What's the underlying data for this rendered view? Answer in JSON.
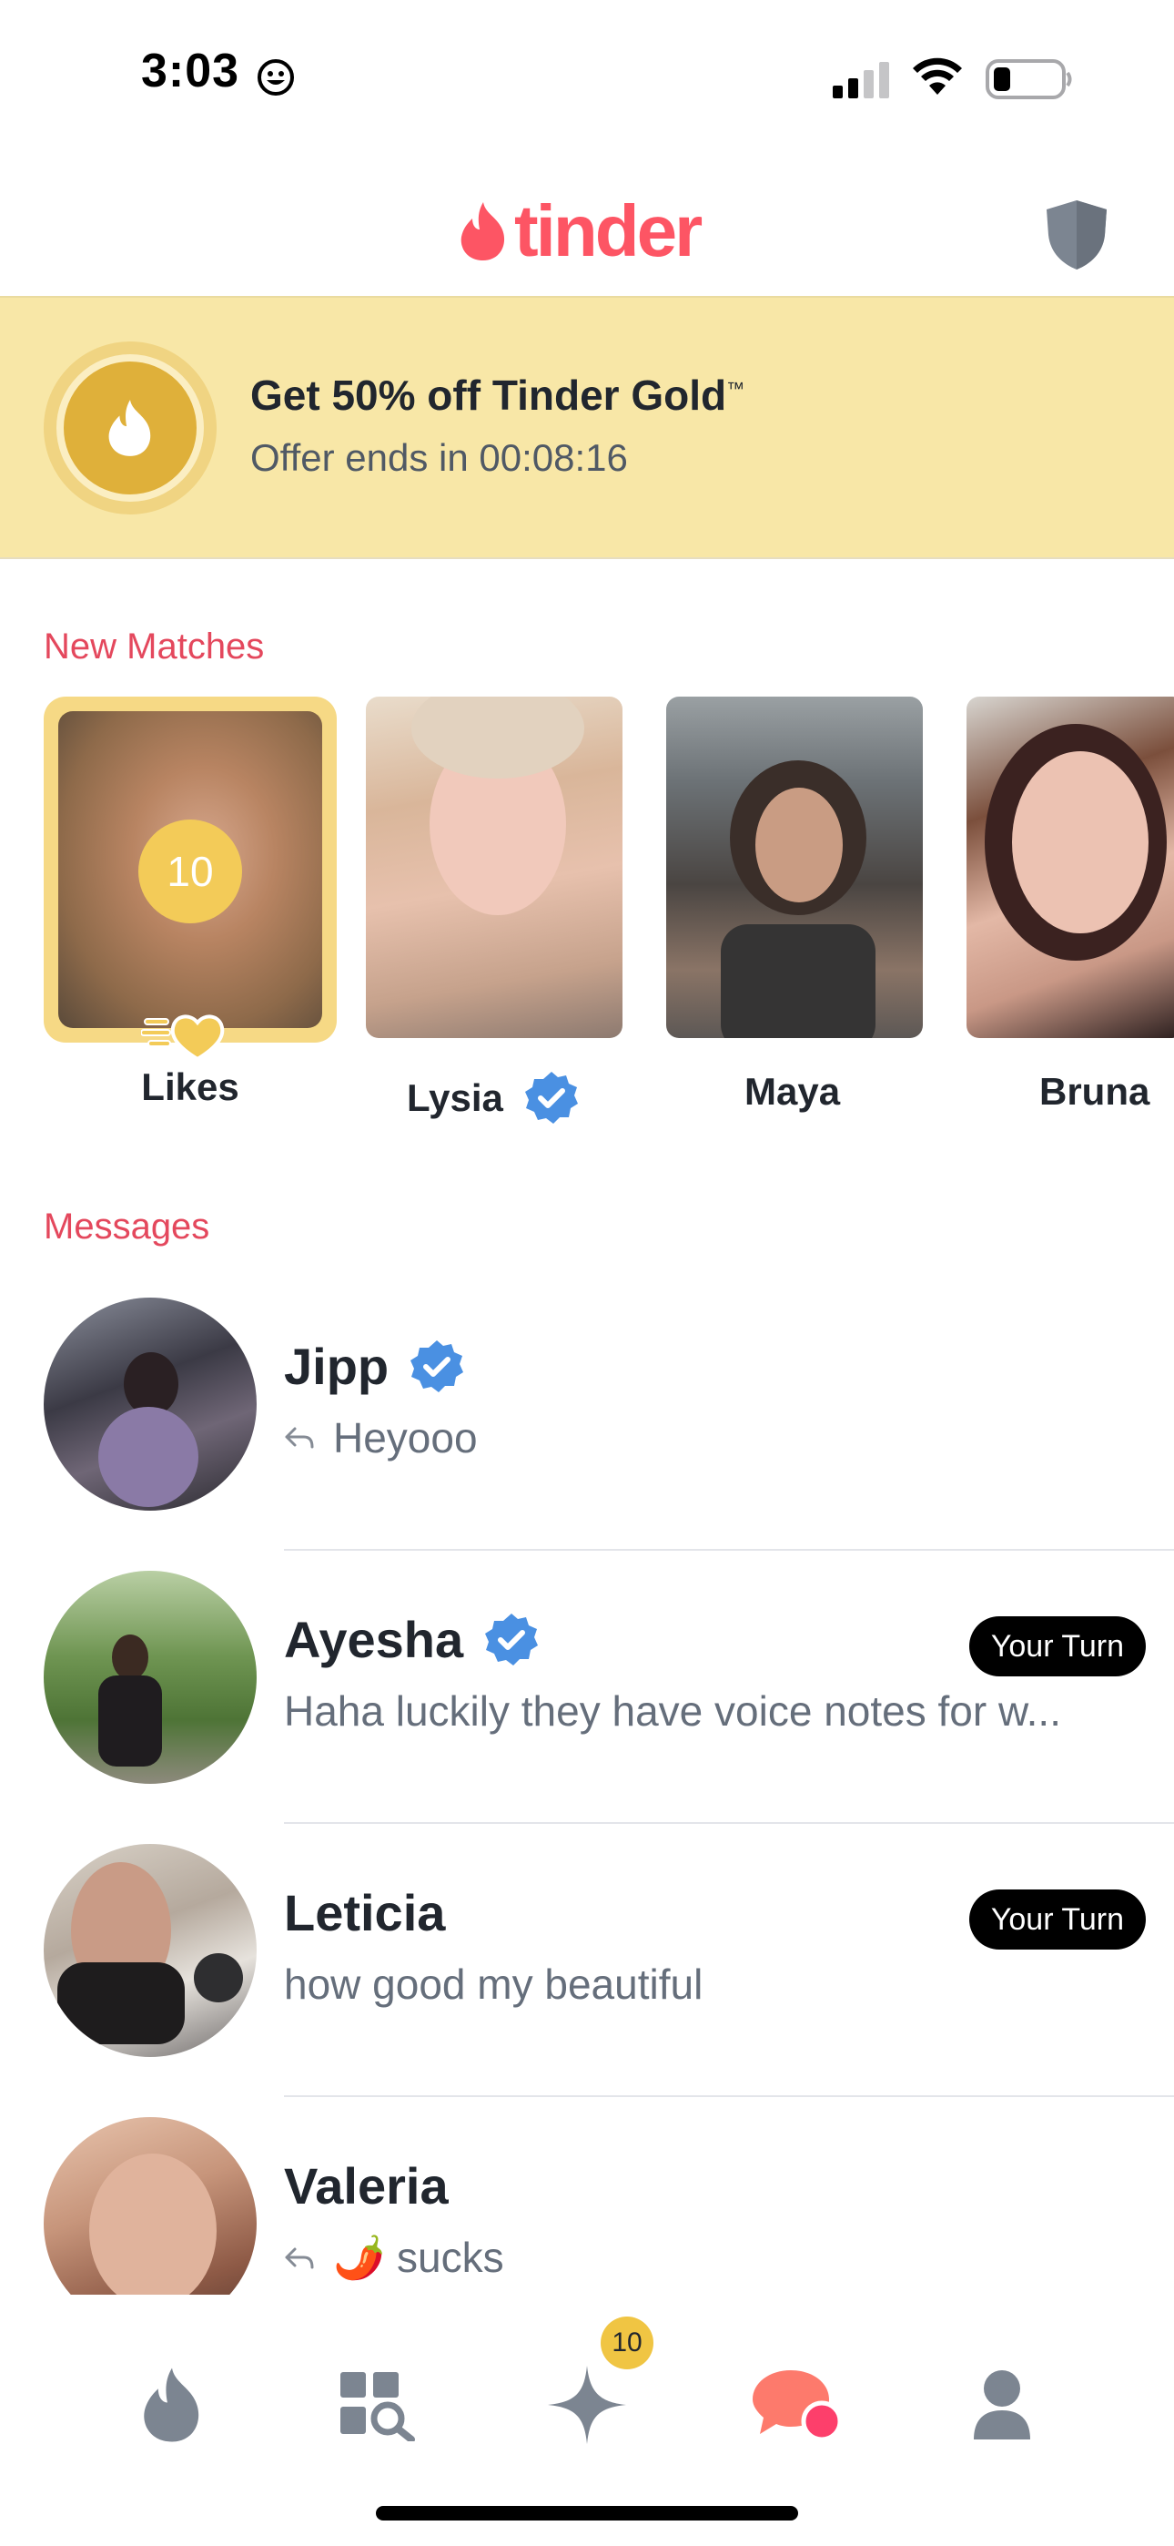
{
  "status_bar": {
    "time": "3:03"
  },
  "header": {
    "logo_text": "tinder"
  },
  "gold_banner": {
    "title": "Get 50% off Tinder Gold",
    "trademark": "™",
    "subtitle": "Offer ends in 00:08:16",
    "accent": "#f8e7a7"
  },
  "new_matches": {
    "label": "New Matches",
    "likes": {
      "count": "10",
      "label": "Likes"
    },
    "matches": [
      {
        "name": "Lysia",
        "verified": true
      },
      {
        "name": "Maya",
        "verified": false
      },
      {
        "name": "Bruna",
        "verified": false
      }
    ]
  },
  "messages": {
    "label": "Messages",
    "items": [
      {
        "name": "Jipp",
        "verified": true,
        "replied": true,
        "preview": "Heyooo",
        "badge": ""
      },
      {
        "name": "Ayesha",
        "verified": true,
        "replied": false,
        "preview": "Haha luckily they have voice notes for w...",
        "badge": "Your Turn"
      },
      {
        "name": "Leticia",
        "verified": false,
        "replied": false,
        "preview": "how good my beautiful",
        "badge": "Your Turn"
      },
      {
        "name": "Valeria",
        "verified": false,
        "replied": true,
        "preview": "🌶️ sucks",
        "badge": ""
      }
    ]
  },
  "tab_bar": {
    "items": [
      "flame-icon",
      "explore-icon",
      "sparkle-icon",
      "chat-icon",
      "profile-icon"
    ],
    "sparkle_badge": "10",
    "active": "chat-icon",
    "accent": "#fd5564"
  }
}
